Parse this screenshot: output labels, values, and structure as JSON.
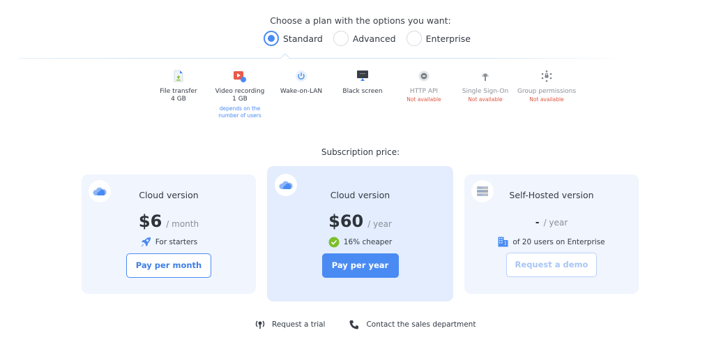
{
  "header": {
    "prompt": "Choose a plan with the options you want:",
    "plans": [
      {
        "label": "Standard",
        "selected": true
      },
      {
        "label": "Advanced",
        "selected": false
      },
      {
        "label": "Enterprise",
        "selected": false
      }
    ]
  },
  "features": [
    {
      "name": "File transfer",
      "value": "4 GB",
      "icon": "file-transfer-icon",
      "available": true
    },
    {
      "name": "Video recording",
      "value": "1 GB",
      "note": "depends on the number of users",
      "icon": "video-recording-icon",
      "available": true
    },
    {
      "name": "Wake-on-LAN",
      "icon": "power-icon",
      "available": true
    },
    {
      "name": "Black screen",
      "icon": "monitor-icon",
      "available": true
    },
    {
      "name": "HTTP API",
      "status": "Not available",
      "icon": "api-icon",
      "available": false
    },
    {
      "name": "Single Sign-On",
      "status": "Not available",
      "icon": "sso-icon",
      "available": false
    },
    {
      "name": "Group permissions",
      "status": "Not available",
      "icon": "group-permissions-icon",
      "available": false
    }
  ],
  "subscription": {
    "title": "Subscription price:",
    "cards": [
      {
        "title": "Cloud version",
        "price": "$6",
        "period": "/ month",
        "perk": "For starters",
        "perk_icon": "rocket-icon",
        "button": "Pay per month"
      },
      {
        "title": "Cloud version",
        "price": "$60",
        "period": "/ year",
        "perk": "16% cheaper",
        "perk_icon": "check-badge-icon",
        "button": "Pay per year"
      },
      {
        "title": "Self-Hosted version",
        "price": "-",
        "period": "/ year",
        "perk": "of 20 users on Enterprise",
        "perk_icon": "building-icon",
        "button": "Request a demo"
      }
    ]
  },
  "footer": {
    "links": [
      {
        "label": "Request a trial",
        "icon": "trial-icon"
      },
      {
        "label": "Contact the sales department",
        "icon": "phone-icon"
      }
    ]
  },
  "colors": {
    "accent": "#4a8bf3",
    "card_bg": "#f0f5fe",
    "card_highlight_bg": "#e3edfd",
    "unavailable": "#e0563f"
  }
}
